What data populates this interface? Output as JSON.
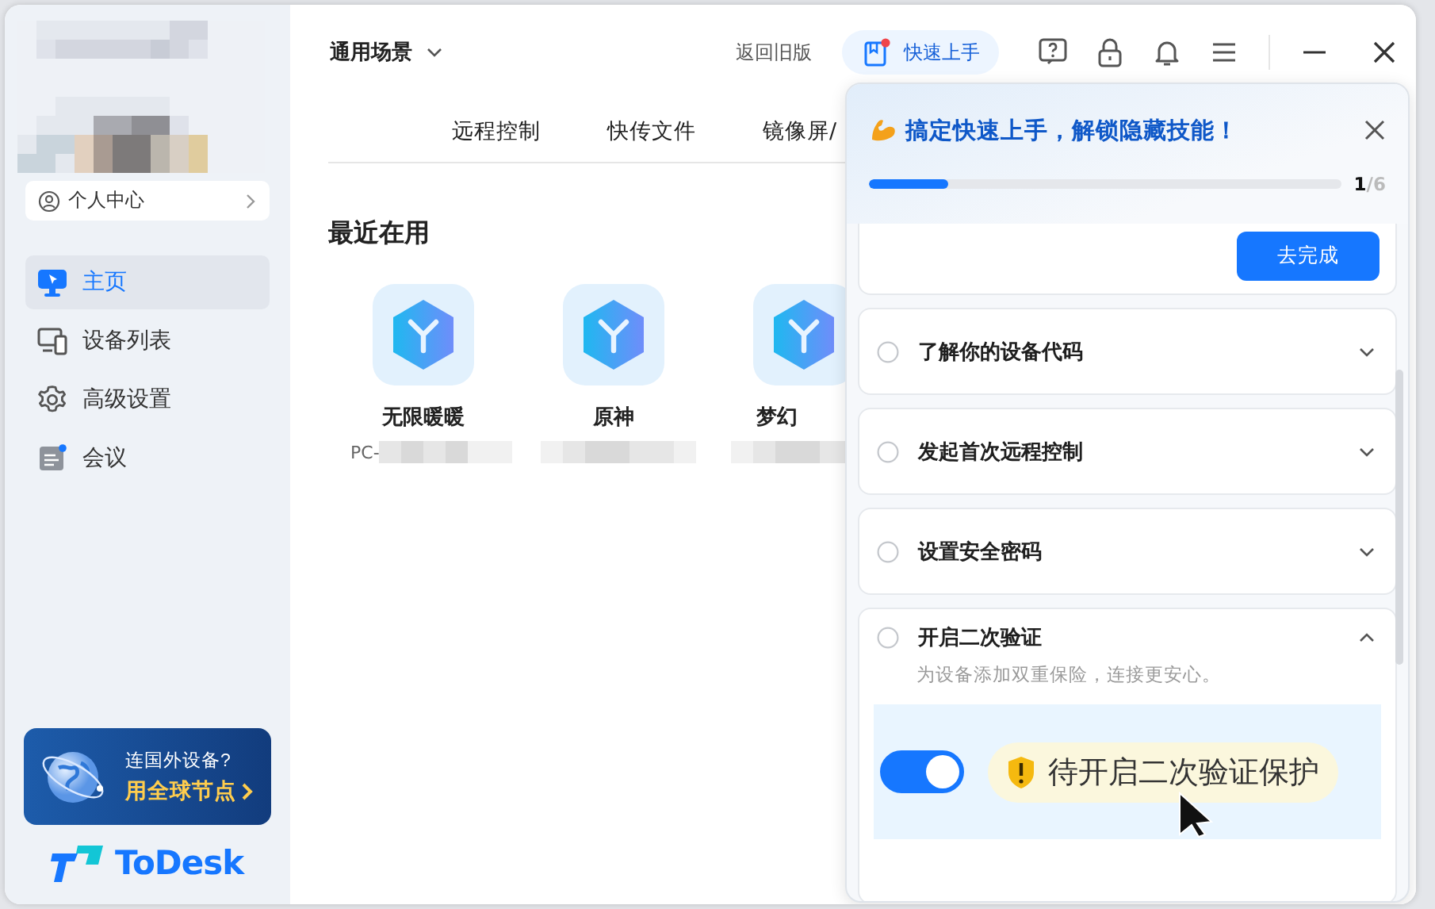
{
  "sidebar": {
    "profile_link": "个人中心",
    "nav": [
      {
        "label": "主页",
        "kind": "monitor",
        "selected": true
      },
      {
        "label": "设备列表",
        "kind": "devices",
        "selected": false
      },
      {
        "label": "高级设置",
        "kind": "gear",
        "selected": false
      },
      {
        "label": "会议",
        "kind": "meeting",
        "selected": false
      }
    ],
    "promo": {
      "line1": "连国外设备?",
      "line2": "用全球节点"
    },
    "logo": "ToDesk"
  },
  "header": {
    "scene": "通用场景",
    "old_version_link": "返回旧版",
    "quick_start": {
      "label": "快速上手",
      "notification": true
    }
  },
  "tabs": [
    {
      "label": "远程控制"
    },
    {
      "label": "快传文件"
    },
    {
      "label": "镜像屏/"
    }
  ],
  "recent": {
    "title": "最近在用",
    "devices": [
      {
        "name": "无限暖暖",
        "id_prefix": "PC-"
      },
      {
        "name": "原神"
      },
      {
        "name": "梦幻"
      }
    ]
  },
  "quick_start_panel": {
    "title": "搞定快速上手，解锁隐藏技能！",
    "progress": {
      "level": 0.167,
      "count": "**1**/6"
    },
    "action_button": "去完成",
    "tasks": [
      {
        "title": "了解你的设备代码",
        "done": false,
        "expanded": false
      },
      {
        "title": "发起首次远程控制",
        "done": false,
        "expanded": false
      },
      {
        "title": "设置安全密码",
        "done": false,
        "expanded": false
      },
      {
        "title": "开启二次验证",
        "done": false,
        "expanded": true,
        "description": "为设备添加双重保险，连接更安心。",
        "demo": {
          "toggle_on": true,
          "status": "待开启二次验证保护"
        }
      }
    ]
  }
}
